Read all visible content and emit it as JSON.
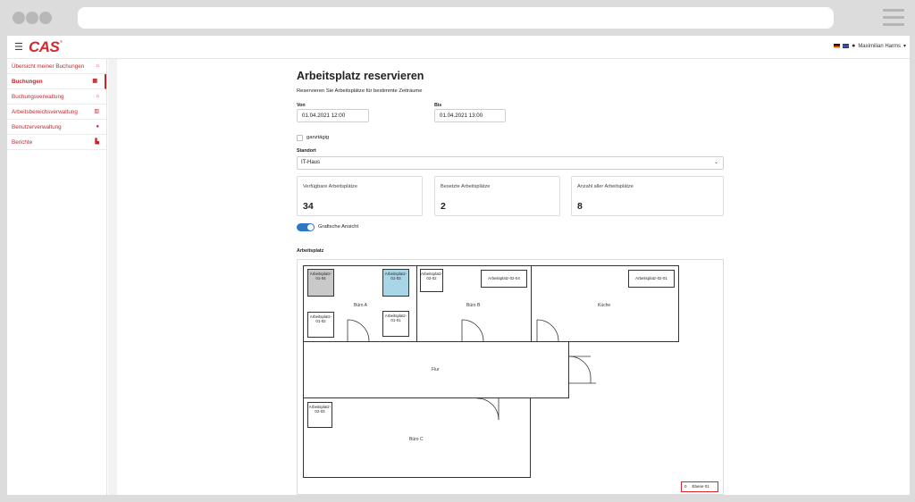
{
  "app": {
    "logo": "CAS",
    "logo_sup": "®",
    "menu_icon": "☰",
    "user_name": "Maximilian Harms",
    "user_caret": "▾"
  },
  "sidebar": {
    "items": [
      {
        "label": "Übersicht meiner Buchungen",
        "icon": "home-icon",
        "glyph": "⌂"
      },
      {
        "label": "Buchungen",
        "icon": "calendar-icon",
        "glyph": "▦"
      },
      {
        "label": "Buchungsverwaltung",
        "icon": "home-icon",
        "glyph": "⌂"
      },
      {
        "label": "Arbeitsbereichsverwaltung",
        "icon": "building-icon",
        "glyph": "▥"
      },
      {
        "label": "Benutzerverwaltung",
        "icon": "user-icon",
        "glyph": "●"
      },
      {
        "label": "Berichte",
        "icon": "bar-chart-icon",
        "glyph": "▙"
      }
    ],
    "active_index": 1
  },
  "form": {
    "title": "Arbeitsplatz reservieren",
    "subtitle": "Reservieren Sie Arbeitsplätze für bestimmte Zeiträume",
    "von_label": "Von",
    "von_value": "01.04.2021 12:00",
    "bis_label": "Bis",
    "bis_value": "01.04.2021 13:00",
    "all_day_label": "ganztägig",
    "location_label": "Standort",
    "location_value": "IT-Haus",
    "location_chevron": "⌄"
  },
  "stats": [
    {
      "label": "Verfügbare Arbeitsplätze",
      "value": "34"
    },
    {
      "label": "Besetzte Arbeitsplätze",
      "value": "2"
    },
    {
      "label": "Anzahl aller Arbeitsplätze",
      "value": "8"
    }
  ],
  "toggle": {
    "label": "Grafische Ansicht",
    "on": true
  },
  "plan": {
    "label": "Arbeitsplatz",
    "rooms": {
      "buero_a": "Büro A",
      "buero_b": "Büro B",
      "kueche": "Küche",
      "flur": "Flur",
      "buero_c": "Büro C"
    },
    "workstations": {
      "ws_01_04": "Arbeitsplatz-01-04",
      "ws_01_03": "Arbeitsplatz-01-03",
      "ws_01_02": "Arbeitsplatz-01-02",
      "ws_01_01": "Arbeitsplatz-01-01",
      "ws_02_02": "Arbeitsplatz-02-02",
      "ws_02_04": "Arbeitsplatz-02-04",
      "ws_02_01": "Arbeitsplatz-02-01",
      "ws_02_03": "Arbeitsplatz-02-03"
    },
    "level_num": "0",
    "level_name": "Ebene 01"
  },
  "colors": {
    "brand": "#d9252b",
    "toggle": "#2b78c5",
    "booked": "#c9c9c9",
    "selected": "#a9d6e6"
  }
}
